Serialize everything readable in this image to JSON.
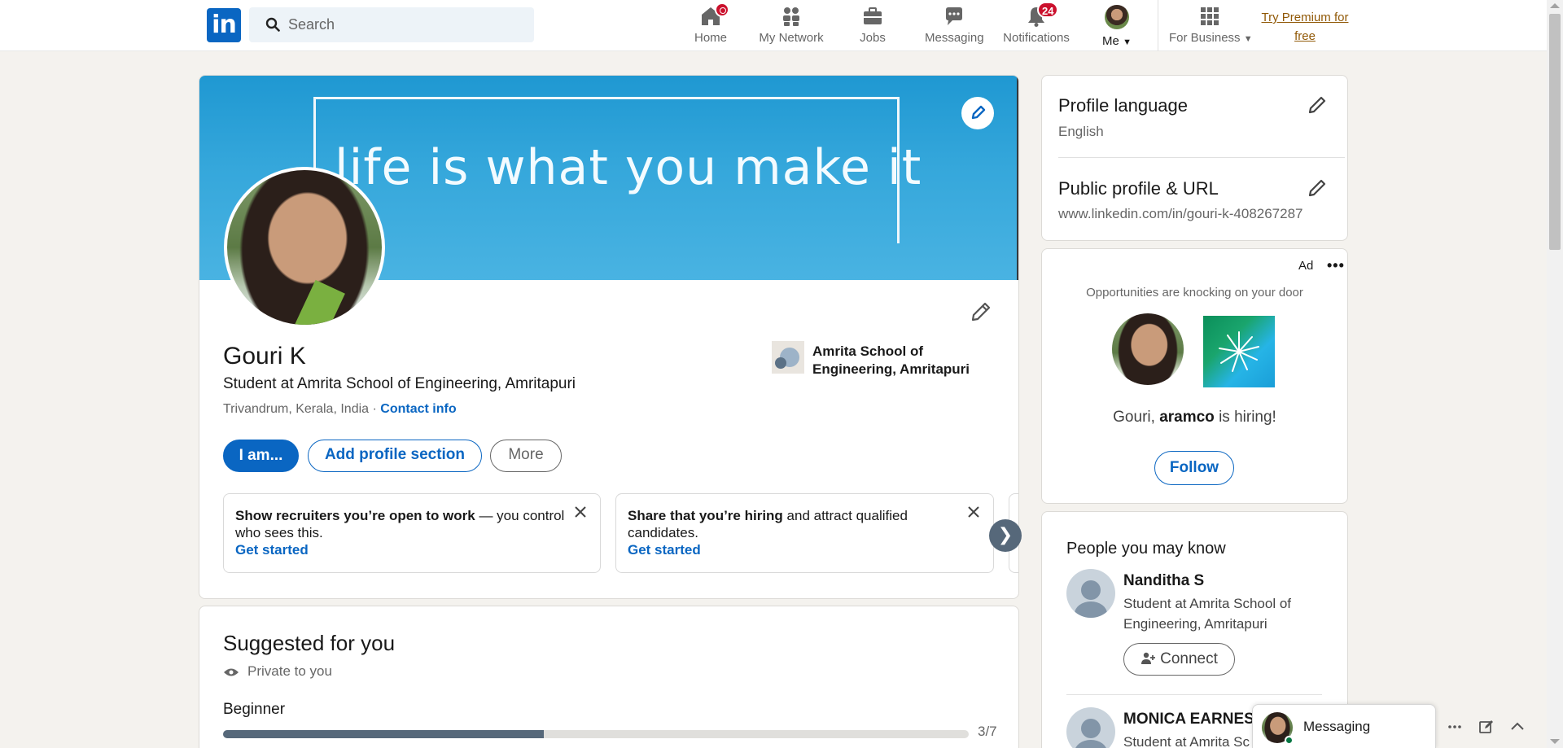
{
  "nav": {
    "logo_text": "in",
    "search_placeholder": "Search",
    "items": [
      {
        "label": "Home",
        "icon": "home-icon"
      },
      {
        "label": "My Network",
        "icon": "my-network-icon"
      },
      {
        "label": "Jobs",
        "icon": "jobs-icon"
      },
      {
        "label": "Messaging",
        "icon": "messaging-icon"
      },
      {
        "label": "Notifications",
        "icon": "notifications-icon",
        "badge": "24"
      },
      {
        "label": "Me",
        "icon": "avatar"
      },
      {
        "label": "For Business",
        "icon": "grid-icon"
      }
    ],
    "premium_line1": "Try Premium for",
    "premium_line2": "free"
  },
  "profile": {
    "banner_text": "life is what you make it",
    "name": "Gouri K",
    "headline": "Student at Amrita School of Engineering, Amritapuri",
    "location": "Trivandrum, Kerala, India",
    "separator": " · ",
    "contact_info": "Contact info",
    "education": "Amrita School of Engineering, Amritapuri",
    "buttons": {
      "open_to": "I am...",
      "add_section": "Add profile section",
      "more": "More"
    },
    "promos": [
      {
        "bold": "Show recruiters you’re open to work",
        "rest": " — you control who sees this.",
        "cta": "Get started"
      },
      {
        "bold": "Share that you’re hiring",
        "rest": " and attract qualified candidates.",
        "cta": "Get started"
      }
    ],
    "carousel_next": "❯"
  },
  "suggested": {
    "title": "Suggested for you",
    "private": "Private to you",
    "level": "Beginner",
    "progress_count": "3/7",
    "progress_fraction": 0.43
  },
  "sidebar": {
    "profile_language_title": "Profile language",
    "profile_language_value": "English",
    "public_profile_title": "Public profile & URL",
    "public_profile_url": "www.linkedin.com/in/gouri-k-408267287"
  },
  "ad": {
    "label": "Ad",
    "more": "•••",
    "tagline": "Opportunities are knocking on your door",
    "hiring_prefix": "Gouri, ",
    "hiring_company": "aramco",
    "hiring_suffix": " is hiring!",
    "follow": "Follow"
  },
  "pymk": {
    "title": "People you may know",
    "people": [
      {
        "name": "Nanditha S",
        "headline": "Student at Amrita School of Engineering, Amritapuri",
        "connect": "Connect"
      },
      {
        "name": "MONICA EARNES",
        "headline": "Student at Amrita Sc"
      }
    ]
  },
  "messaging_dock": {
    "label": "Messaging"
  },
  "colors": {
    "brand": "#0a66c2",
    "badge": "#cb112d",
    "premium": "#915907",
    "background": "#f4f2ee"
  }
}
